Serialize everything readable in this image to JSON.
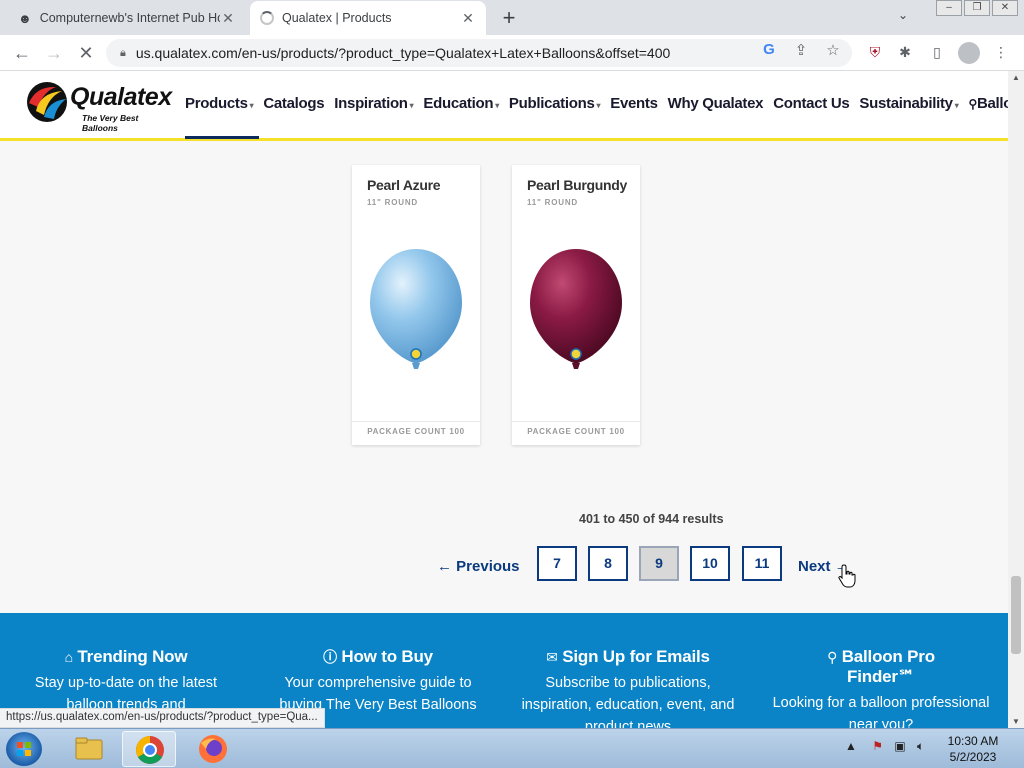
{
  "browser": {
    "tabs": [
      {
        "title": "Computernewb's Internet Pub Ho",
        "active": false
      },
      {
        "title": "Qualatex | Products",
        "active": true
      }
    ],
    "url": "us.qualatex.com/en-us/products/?product_type=Qualatex+Latex+Balloons&offset=400",
    "status_url": "https://us.qualatex.com/en-us/products/?product_type=Qua..."
  },
  "site": {
    "logo_text": "Qualatex",
    "logo_tagline": "The Very Best Balloons",
    "nav": [
      {
        "label": "Products",
        "dropdown": true
      },
      {
        "label": "Catalogs",
        "dropdown": false
      },
      {
        "label": "Inspiration",
        "dropdown": true
      },
      {
        "label": "Education",
        "dropdown": true
      },
      {
        "label": "Publications",
        "dropdown": true
      },
      {
        "label": "Events",
        "dropdown": false
      },
      {
        "label": "Why Qualatex",
        "dropdown": false
      },
      {
        "label": "Contact Us",
        "dropdown": false
      },
      {
        "label": "Sustainability",
        "dropdown": true
      },
      {
        "label": "Balloon Pro Fin",
        "dropdown": false
      }
    ]
  },
  "products": [
    {
      "name": "Pearl Azure",
      "size": "11\" ROUND",
      "package": "PACKAGE COUNT 100",
      "color": "#8cc3ea"
    },
    {
      "name": "Pearl Burgundy",
      "size": "11\" ROUND",
      "package": "PACKAGE COUNT 100",
      "color": "#7a1438"
    }
  ],
  "pagination": {
    "results_text": "401 to 450 of 944 results",
    "previous": "← Previous",
    "next": "Next →",
    "pages": [
      "7",
      "8",
      "9",
      "10",
      "11"
    ],
    "current": "9"
  },
  "footer": {
    "columns": [
      {
        "icon": "trending-icon",
        "title": "Trending Now",
        "desc": "Stay up-to-date on the latest balloon trends and"
      },
      {
        "icon": "info-icon",
        "title": "How to Buy",
        "desc": "Your comprehensive guide to buying The Very Best Balloons"
      },
      {
        "icon": "email-icon",
        "title": "Sign Up for Emails",
        "desc": "Subscribe to publications, inspiration, education, event, and product news"
      },
      {
        "icon": "location-pin-icon",
        "title": "Balloon Pro Finder℠",
        "desc": "Looking for a balloon professional near you?"
      }
    ]
  },
  "taskbar": {
    "time": "10:30 AM",
    "date": "5/2/2023"
  },
  "colors": {
    "brand_navy": "#0b3a7e",
    "footer_blue": "#0a84c6",
    "header_accent": "#f5e12a"
  }
}
